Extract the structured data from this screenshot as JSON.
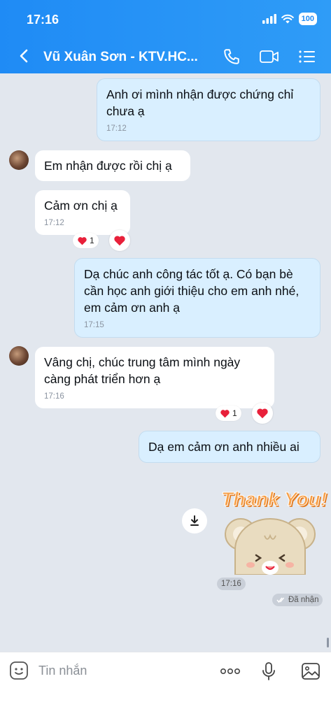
{
  "status_bar": {
    "time": "17:16",
    "battery": "100"
  },
  "header": {
    "title": "Vũ Xuân Sơn - KTV.HC...",
    "icons": [
      "back-chevron",
      "phone",
      "video-camera",
      "menu-list"
    ]
  },
  "messages": [
    {
      "from": "me",
      "text": "Anh ơi mình nhận được chứng chỉ chưa ạ",
      "time": "17:12"
    },
    {
      "from": "them",
      "text": "Em nhận được rồi chị ạ",
      "time": ""
    },
    {
      "from": "them",
      "text": "Cảm ơn chị ạ",
      "time": "17:12",
      "reaction_count": "1"
    },
    {
      "from": "me",
      "text": "Dạ chúc anh công tác tốt ạ. Có bạn bè cần học anh giới thiệu cho em anh nhé, em cảm ơn anh ạ",
      "time": "17:15"
    },
    {
      "from": "them",
      "text": "Vâng chị, chúc trung tâm mình ngày càng phát triển hơn ạ",
      "time": "17:16",
      "reaction_count": "1"
    },
    {
      "from": "me",
      "text": "Dạ em cảm ơn anh nhiều ai",
      "time": ""
    }
  ],
  "sticker": {
    "text": "Thank You!",
    "time": "17:16",
    "status": "Đã nhận"
  },
  "input": {
    "placeholder": "Tin nhắn"
  },
  "colors": {
    "header": "#1f8bf5",
    "my_bubble": "#d9efff",
    "background": "#e2e7ee",
    "heart": "#e8203a"
  }
}
